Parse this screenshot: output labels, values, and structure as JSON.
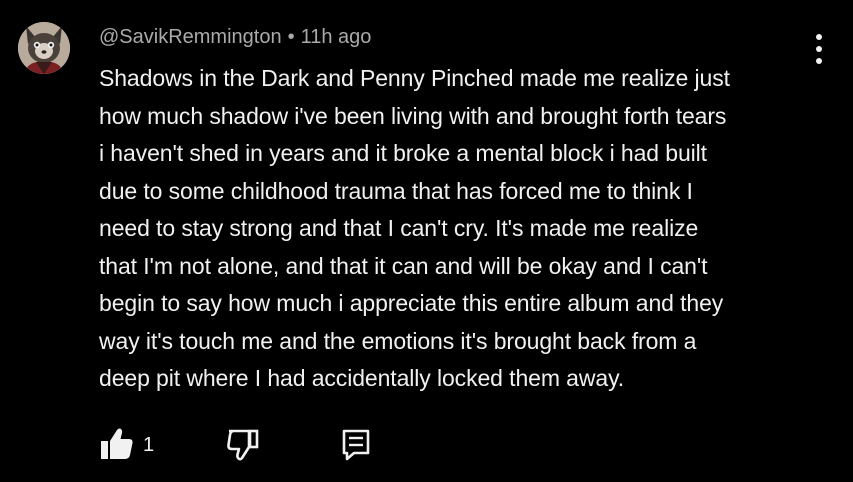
{
  "comment": {
    "author": "@SavikRemmington",
    "separator": "•",
    "timestamp": "11h ago",
    "avatar_icon": "user-avatar",
    "menu_icon": "more-vertical-icon",
    "lines": [
      "Shadows in the Dark and Penny Pinched made me realize just",
      "how much shadow i've been living with and brought forth tears",
      "i haven't shed in years and it broke a mental block i had built",
      "due to some childhood trauma that has forced me to think I",
      "need to stay strong and that I can't cry. It's made me realize",
      "that I'm not alone, and that it can and will be okay and I can't",
      "begin to say how much i appreciate this entire album and they",
      "way it's touch me and the emotions it's brought back from a",
      "deep pit where I had accidentally locked them away."
    ],
    "actions": {
      "like_icon": "thumbs-up-icon",
      "like_count": "1",
      "dislike_icon": "thumbs-down-icon",
      "reply_icon": "reply-comment-icon"
    }
  },
  "colors": {
    "background": "#000000",
    "primary_text": "#f1f1f1",
    "secondary_text": "#aaaaaa"
  }
}
